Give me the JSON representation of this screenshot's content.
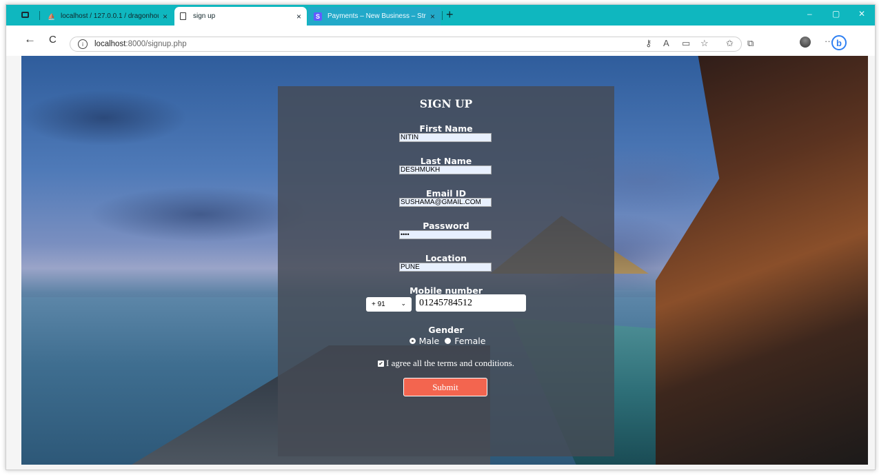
{
  "browser": {
    "tabs": [
      {
        "title": "localhost / 127.0.0.1 / dragonhou",
        "close": "×"
      },
      {
        "title": "sign up",
        "close": "×"
      },
      {
        "title": "Payments – New Business – Strip",
        "close": "×"
      }
    ],
    "new_tab": "+",
    "window_controls": {
      "minimize": "–",
      "maximize": "▢",
      "close": "✕"
    },
    "nav": {
      "back": "←",
      "reload": "C"
    },
    "url_host": "localhost",
    "url_rest": ":8000/signup.php",
    "more": "···",
    "bing_letter": "b"
  },
  "form": {
    "title": "SIGN UP",
    "first_name_label": "First Name",
    "first_name_value": "NITIN",
    "last_name_label": "Last Name",
    "last_name_value": "DESHMUKH",
    "email_label": "Email ID",
    "email_value": "SUSHAMA@GMAIL.COM",
    "password_label": "Password",
    "password_value": "••••",
    "location_label": "Location",
    "location_value": "PUNE",
    "mobile_label": "Mobile number",
    "country_code": "+ 91",
    "mobile_value": "01245784512",
    "gender_label": "Gender",
    "gender_male": "Male",
    "gender_female": "Female",
    "terms_text": "I agree all the terms and conditions.",
    "terms_checked": true,
    "submit_label": "Submit"
  },
  "colors": {
    "tabbar": "#0fb7bf",
    "submit": "#f3654f",
    "panel": "#464a54"
  }
}
